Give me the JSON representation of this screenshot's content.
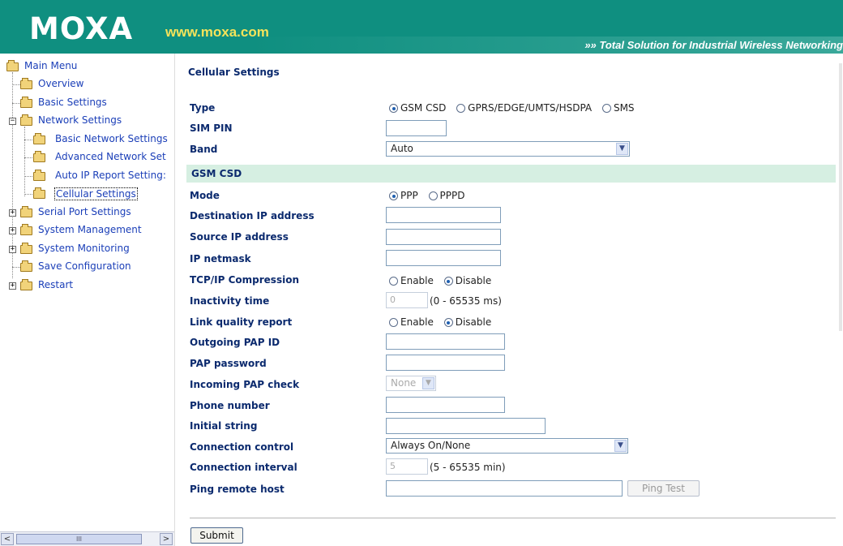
{
  "header": {
    "logo": "MOXA",
    "site": "www.moxa.com",
    "tagline": "»» Total Solution for Industrial Wireless Networking"
  },
  "sidebar": {
    "items": [
      {
        "label": "Main Menu"
      },
      {
        "label": "Overview"
      },
      {
        "label": "Basic Settings"
      },
      {
        "label": "Network Settings"
      },
      {
        "label": "Basic Network Settings"
      },
      {
        "label": "Advanced Network Set"
      },
      {
        "label": "Auto IP Report Setting:"
      },
      {
        "label": "Cellular Settings"
      },
      {
        "label": "Serial Port Settings"
      },
      {
        "label": "System Management"
      },
      {
        "label": "System Monitoring"
      },
      {
        "label": "Save Configuration"
      },
      {
        "label": "Restart"
      }
    ],
    "scroll_left": "<",
    "scroll_right": ">",
    "scroll_grip": "III"
  },
  "main": {
    "title": "Cellular Settings",
    "type": {
      "label": "Type",
      "options": [
        "GSM CSD",
        "GPRS/EDGE/UMTS/HSDPA",
        "SMS"
      ],
      "selected": "GSM CSD"
    },
    "sim_pin": {
      "label": "SIM PIN",
      "value": ""
    },
    "band": {
      "label": "Band",
      "value": "Auto"
    },
    "section": "GSM CSD",
    "mode": {
      "label": "Mode",
      "options": [
        "PPP",
        "PPPD"
      ],
      "selected": "PPP"
    },
    "dest_ip": {
      "label": "Destination IP address",
      "value": ""
    },
    "source_ip": {
      "label": "Source IP address",
      "value": ""
    },
    "netmask": {
      "label": "IP netmask",
      "value": ""
    },
    "tcpip": {
      "label": "TCP/IP Compression",
      "options": [
        "Enable",
        "Disable"
      ],
      "selected": "Disable"
    },
    "inactivity": {
      "label": "Inactivity time",
      "value": "0",
      "hint": "(0 - 65535 ms)"
    },
    "link_quality": {
      "label": "Link quality report",
      "options": [
        "Enable",
        "Disable"
      ],
      "selected": "Disable"
    },
    "pap_id": {
      "label": "Outgoing PAP ID",
      "value": ""
    },
    "pap_password": {
      "label": "PAP password",
      "value": ""
    },
    "pap_check": {
      "label": "Incoming PAP check",
      "value": "None"
    },
    "phone": {
      "label": "Phone number",
      "value": ""
    },
    "init_string": {
      "label": "Initial string",
      "value": ""
    },
    "conn_control": {
      "label": "Connection control",
      "value": "Always On/None"
    },
    "conn_interval": {
      "label": "Connection interval",
      "value": "5",
      "hint": "(5 - 65535 min)"
    },
    "ping": {
      "label": "Ping remote host",
      "value": "",
      "button": "Ping Test"
    },
    "submit": "Submit"
  }
}
